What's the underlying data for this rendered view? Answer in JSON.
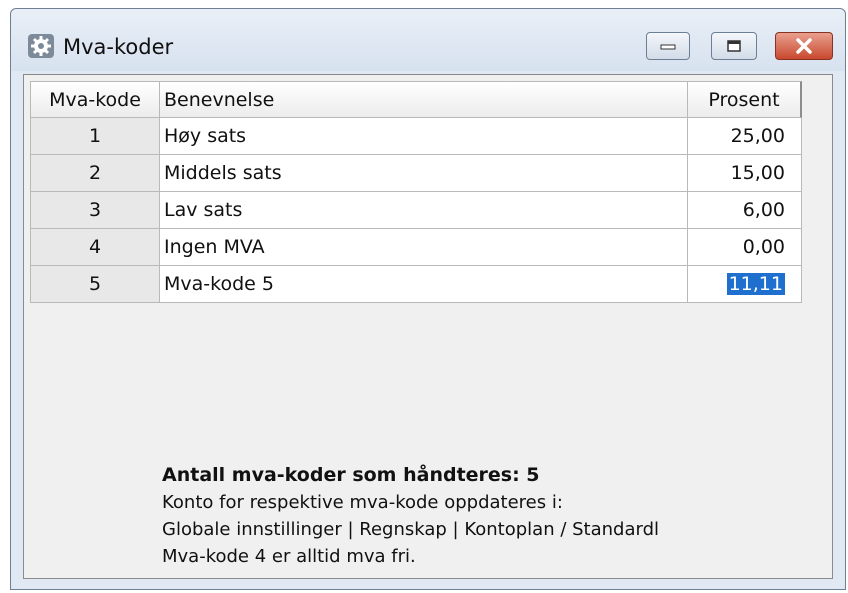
{
  "window": {
    "title": "Mva-koder"
  },
  "table": {
    "headers": [
      "Mva-kode",
      "Benevnelse",
      "Prosent"
    ],
    "rows": [
      {
        "code": "1",
        "name": "Høy sats",
        "percent": "25,00"
      },
      {
        "code": "2",
        "name": "Middels sats",
        "percent": "15,00"
      },
      {
        "code": "3",
        "name": "Lav sats",
        "percent": "6,00"
      },
      {
        "code": "4",
        "name": "Ingen MVA",
        "percent": "0,00"
      },
      {
        "code": "5",
        "name": "Mva-kode 5",
        "percent": "11,11"
      }
    ]
  },
  "info": {
    "count_label": "Antall mva-koder som håndteres: 5",
    "line1": "Konto for respektive mva-kode oppdateres i:",
    "line2": "Globale innstillinger | Regnskap | Kontoplan / Standardl",
    "line3": "Mva-kode 4 er alltid mva fri."
  },
  "colors": {
    "selection": "#1f6fce",
    "close_button": "#c8482e"
  }
}
